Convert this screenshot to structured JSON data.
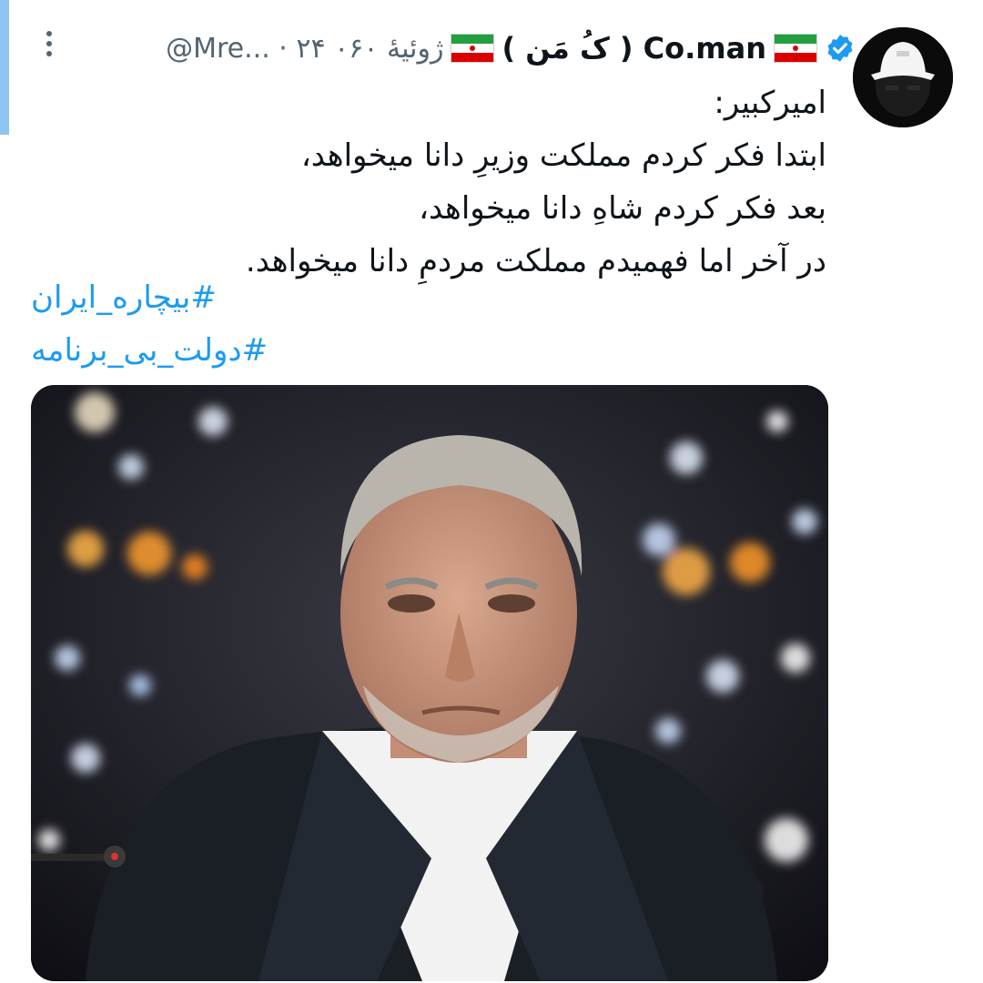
{
  "tweet": {
    "display_name": "( کُ مَن ) Co.man",
    "handle_time": "@Mre... · ۲۴ ژوئیهٔ ۰۶۰",
    "lines": [
      "امیرکبیر:",
      "ابتدا فکر کردم مملکت وزیرِ دانا میخواهد،",
      "بعد فکر کردم شاهِ دانا میخواهد،",
      "در آخر اما فهمیدم مملکت مردمِ دانا میخواهد."
    ],
    "hashtags": [
      "#بیچاره_ایران",
      "#دولت_بی_برنامه"
    ]
  },
  "colors": {
    "link": "#1d9bf0",
    "verified": "#1d9bf0",
    "text": "#0f1419",
    "muted": "#536471",
    "accent_bar": "#8ec5f0"
  },
  "icons": {
    "verified": "verified-badge-icon",
    "more": "more-vertical-icon",
    "flag": "iran-flag-icon"
  }
}
